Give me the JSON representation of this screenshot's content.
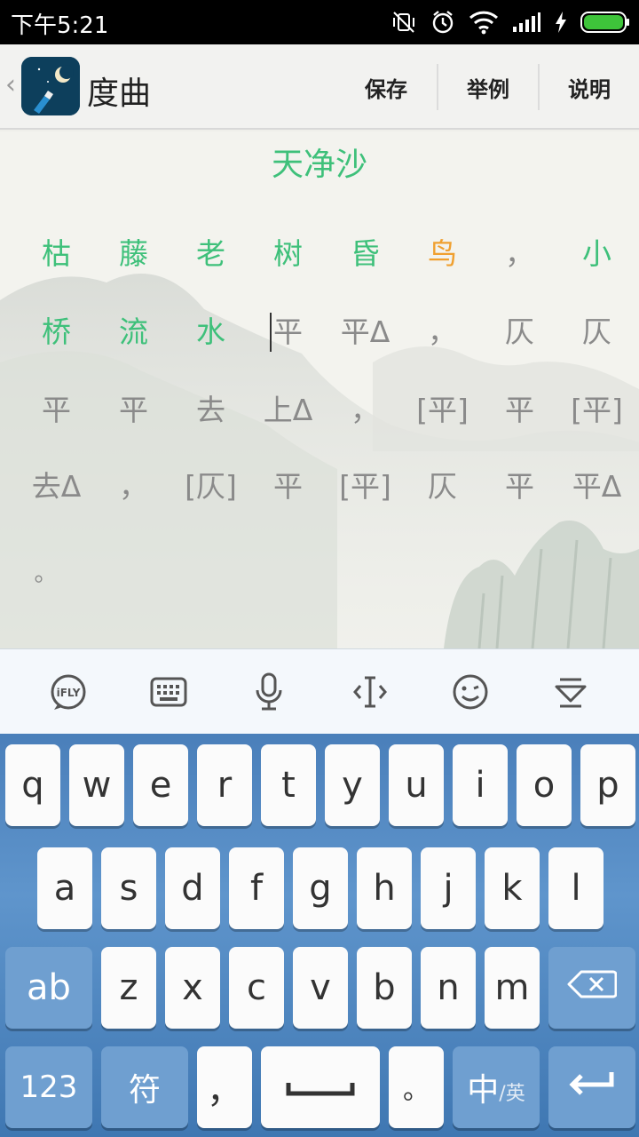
{
  "status_bar": {
    "time": "下午5:21"
  },
  "app_bar": {
    "back_symbol": "‹",
    "title": "度曲",
    "actions": [
      "保存",
      "举例",
      "说明"
    ]
  },
  "content": {
    "poem_title": "天净沙",
    "rows": [
      [
        "枯",
        "藤",
        "老",
        "树",
        "昏",
        "鸟",
        "，",
        "小"
      ],
      [
        "桥",
        "流",
        "水",
        "平",
        "平Δ",
        "，",
        "仄",
        "仄"
      ],
      [
        "平",
        "平",
        "去",
        "上Δ",
        "，",
        "[平]",
        "平",
        "[平]"
      ],
      [
        "去Δ",
        "，",
        "[仄]",
        "平",
        "[平]",
        "仄",
        "平",
        "平Δ"
      ],
      [
        "。"
      ]
    ],
    "colors": {
      "entered": "#3ec07a",
      "current": "#f0a030",
      "pattern": "#8a8a8a"
    },
    "current_cell": "鸟"
  },
  "keyboard_toolbar": {
    "icons": [
      "ifly-logo-icon",
      "keyboard-icon",
      "microphone-icon",
      "cursor-icon",
      "emoji-icon",
      "hide-keyboard-icon"
    ],
    "ifly_text": "iFLY"
  },
  "keyboard": {
    "row1": [
      "q",
      "w",
      "e",
      "r",
      "t",
      "y",
      "u",
      "i",
      "o",
      "p"
    ],
    "row2": [
      "a",
      "s",
      "d",
      "f",
      "g",
      "h",
      "j",
      "k",
      "l"
    ],
    "row3": [
      "ab",
      "z",
      "x",
      "c",
      "v",
      "b",
      "n",
      "m"
    ],
    "row4": [
      "123",
      "符",
      "，",
      "。"
    ],
    "lang_main": "中",
    "lang_sub": "/英",
    "accent": "#4a7fba"
  }
}
